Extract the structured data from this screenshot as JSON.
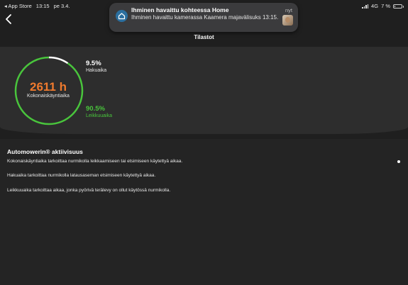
{
  "status_bar": {
    "back_app": "App Store",
    "time": "13:15",
    "date": "pe 3.4.",
    "network": "4G",
    "battery": "7 %",
    "battery_level": 0.07
  },
  "notification": {
    "title": "Ihminen havaittu kohteessa Home",
    "body": "Ihminen havaittu kamerassa Kaamera  majavälisuks 13:15.",
    "time": "nyt"
  },
  "header": {
    "title": "Tilastot"
  },
  "stats": {
    "total_value": "2611 h",
    "total_label": "Kokonaiskäyntiaika",
    "search_pct": "9.5%",
    "search_label": "Hakuaika",
    "search_fraction": 0.095,
    "cutting_pct": "90.5%",
    "cutting_label": "Leikkuuaika",
    "cutting_fraction": 0.905
  },
  "activity": {
    "title": "Automowerin® aktiivisuus",
    "p1": "Kokonaiskäyntiaika tarkoittaa nurmikolla leikkaamiseen tai etsimiseen käytettyä aikaa.",
    "p2": "Hakuaika tarkoittaa nurmikolla latausaseman etsimiseen käytettyä aikaa.",
    "p3": "Leikkuuaika tarkoittaa aikaa, jonka pyörivä terälevy on ollut käytössä nurmikolla."
  },
  "colors": {
    "cutting": "#49c53c",
    "search": "#ffffff",
    "total_value": "#ef7a2e",
    "background": "#1f1f1f"
  }
}
